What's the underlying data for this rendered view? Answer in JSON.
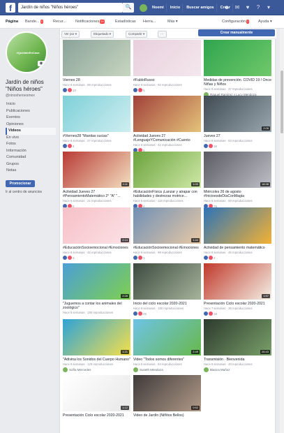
{
  "topbar": {
    "search_value": "Jardín de niños \"Niños héroes\"",
    "nav": [
      "Noemi",
      "Inicio",
      "Buscar amigos",
      "Crear"
    ]
  },
  "tabs": [
    {
      "label": "Página",
      "active": true
    },
    {
      "label": "Bande...",
      "badge": "3"
    },
    {
      "label": "Recur...",
      "badge": ""
    },
    {
      "label": "Notificaciones",
      "badge": "20"
    },
    {
      "label": "Estadísticas"
    },
    {
      "label": "Herra..."
    },
    {
      "label": "Más ▾"
    },
    {
      "label": "Configuración",
      "badge": "1"
    },
    {
      "label": "Ayuda ▾"
    }
  ],
  "sidebar": {
    "profile_text": "#QuédateEnCasa",
    "page_name": "Jardín de niños \"Niños héroes\"",
    "username": "@ninosheroesmex",
    "links": [
      {
        "label": "Inicio"
      },
      {
        "label": "Publicaciones"
      },
      {
        "label": "Eventos"
      },
      {
        "label": "Opiniones"
      },
      {
        "label": "Videos",
        "active": true
      },
      {
        "label": "En vivo"
      },
      {
        "label": "Fotos"
      },
      {
        "label": "Información"
      },
      {
        "label": "Comunidad"
      },
      {
        "label": "Grupos"
      },
      {
        "label": "Notas"
      }
    ],
    "promote_label": "Promocionar",
    "ads_center": "Ir al centro de anuncios"
  },
  "toolbar": {
    "sort": "Ver por ▾",
    "filter": "Etiquetado ▾",
    "share": "Compartir ▾",
    "create": "Crear manualmente"
  },
  "videos": [
    {
      "title": "Viernes 28",
      "meta": "Hace 6 semanas · 88 reproducciones",
      "reactions": "10",
      "duration": "",
      "colors": [
        "#8aa39a",
        "#c8d6c0"
      ]
    },
    {
      "title": "#FabloRusso",
      "meta": "Hace 6 semanas · 92 reproducciones",
      "reactions": "5",
      "duration": "",
      "colors": [
        "#e8d0dc",
        "#f4e7ed"
      ]
    },
    {
      "title": "Medidas de prevención. COVID 19 / Once Niñas y Niños",
      "meta": "Hace 6 semanas · 37 reproducciones",
      "reactions": "",
      "owner": "Raquel Ramírez y Lucy Mendoza",
      "duration": "",
      "colors": [
        "#2fa54e",
        "#70c86a"
      ]
    },
    {
      "title": "#Viernes28 \"Manitas sucias\"",
      "meta": "Hace 6 semanas · 27 reproducciones",
      "reactions": "4",
      "duration": "",
      "colors": [
        "#7ed0d8",
        "#cfeef0"
      ]
    },
    {
      "title": "Actividad Jueves 27 #LenguajeYComunicación #Cuento",
      "meta": "Hace 6 semanas · 42 reproducciones",
      "reactions": "5",
      "duration": "",
      "colors": [
        "#a2403a",
        "#e4c37a"
      ]
    },
    {
      "title": "Jueves 27",
      "meta": "Hace 6 semanas · 83 reproducciones",
      "reactions": "16",
      "duration": "2:05",
      "colors": [
        "#3f4a52",
        "#9aa7ae"
      ]
    },
    {
      "title": "Actividad Jueves 27 #PensamientoMatemático 2° \"A\" \"...",
      "meta": "Hace 6 semanas · 21 reproducciones",
      "reactions": "5",
      "duration": "4:11",
      "colors": [
        "#b83a35",
        "#f3e0c0"
      ]
    },
    {
      "title": "#EducaciónFísica ¡Lanzar y atrapar con habilidades y destrezas motrice...",
      "meta": "Hace 6 semanas · 116 reproducciones",
      "reactions": "4",
      "duration": "1:00",
      "colors": [
        "#6aa33c",
        "#cfe8a8"
      ]
    },
    {
      "title": "Miércoles 26 de agosto #InicioesdeDíaConMagia",
      "meta": "Hace 6 semanas · 59 reproducciones",
      "reactions": "76",
      "duration": "18:38",
      "colors": [
        "#5b5a62",
        "#bfc0c8"
      ]
    },
    {
      "title": "#EducaciónSocioemocional #Emociones",
      "meta": "Hace 6 semanas · 45 reproducciones",
      "reactions": "3",
      "duration": "2:14",
      "colors": [
        "#f6c0c7",
        "#fbe2e6"
      ]
    },
    {
      "title": "#EducaciónSocioemocional #Emociones",
      "meta": "Hace 6 semanas · 98 reproducciones",
      "reactions": "3",
      "duration": "1:44",
      "colors": [
        "#6f8fb5",
        "#e8c9a6"
      ]
    },
    {
      "title": "Actividad de pensamiento matemático",
      "meta": "Hace 6 semanas · 46 reproducciones",
      "reactions": "2",
      "duration": "",
      "colors": [
        "#2e73b8",
        "#f3b233"
      ]
    },
    {
      "title": "\"Juguemos a contar los animales del zoológico\"",
      "meta": "Hace 6 semanas · 180 reproducciones",
      "reactions": "",
      "duration": "2:28",
      "colors": [
        "#4a9fd6",
        "#7fd04f"
      ]
    },
    {
      "title": "Inicio del ciclo escolar 2020-2021",
      "meta": "Hace 6 semanas · 150 reproducciones",
      "reactions": "25",
      "duration": "",
      "colors": [
        "#3b4a3e",
        "#a6b49c"
      ]
    },
    {
      "title": "Presentación Ciclo escolar 2020-2021",
      "meta": "Hace 7 semanas · 38 reproducciones",
      "reactions": "18",
      "duration": "1:57",
      "colors": [
        "#c0392b",
        "#f4f0e6"
      ]
    },
    {
      "title": "\"Adivina los Sonidos del Cuerpo Humano\"",
      "meta": "Hace 6 semanas · 129 reproducciones",
      "reactions": "",
      "owner": "Sofía Mercedes",
      "duration": "1:21",
      "colors": [
        "#2fa3d6",
        "#f5e04a"
      ]
    },
    {
      "title": "Video \"Todos somos diferentes\"",
      "meta": "Hace 6 semanas · 54 reproducciones",
      "reactions": "",
      "owner": "Suseth Mendoza",
      "duration": "2:49",
      "colors": [
        "#6dc3e6",
        "#68b84b"
      ]
    },
    {
      "title": "Transmisión · Bienvenida",
      "meta": "Hace 6 semanas · 48 reproducciones",
      "reactions": "",
      "owner": "Bianca Muñoz",
      "duration": "26:43",
      "colors": [
        "#2c3a2d",
        "#7aa06a"
      ]
    },
    {
      "title": "Presentación Ciclo escolar 2020-2021",
      "meta": "",
      "reactions": "",
      "duration": "1:12",
      "colors": [
        "#ffffff",
        "#e8e8e8"
      ]
    },
    {
      "title": "Video de Jardín (Niñitos Bellos)",
      "meta": "",
      "reactions": "",
      "duration": "0:52",
      "colors": [
        "#3e3a3a",
        "#b19a88"
      ]
    }
  ],
  "colors": {
    "brand": "#3b5998",
    "button": "#4267b2"
  }
}
